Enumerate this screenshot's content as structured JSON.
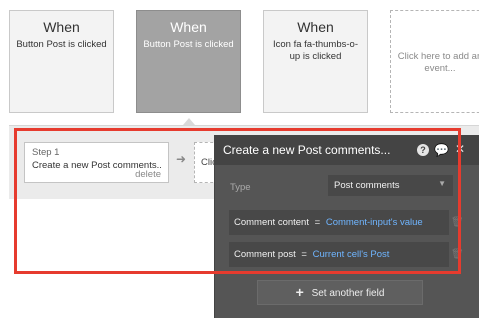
{
  "events": [
    {
      "title": "When",
      "subtitle": "Button Post is clicked"
    },
    {
      "title": "When",
      "subtitle": "Button Post is clicked"
    },
    {
      "title": "When",
      "subtitle": "Icon fa fa-thumbs-o-up is clicked"
    },
    {
      "subtitle": "Click here to add an event..."
    }
  ],
  "workflow": {
    "step_number": "Step 1",
    "step_name": "Create a new Post comments...",
    "delete_label": "delete",
    "next_step_label": "Click here to add an action..."
  },
  "panel": {
    "title": "Create a new Post comments...",
    "type_label": "Type",
    "type_value": "Post comments",
    "fields": [
      {
        "name": "Comment content",
        "eq": "=",
        "value": "Comment-input's value"
      },
      {
        "name": "Comment post",
        "eq": "=",
        "value": "Current cell's Post"
      }
    ],
    "set_field_label": "Set another field"
  },
  "colors": {
    "highlight": "#e63b2e",
    "panel_bg": "#555555",
    "link_value": "#6fb5ff",
    "selected_event": "#a3a3a3"
  }
}
